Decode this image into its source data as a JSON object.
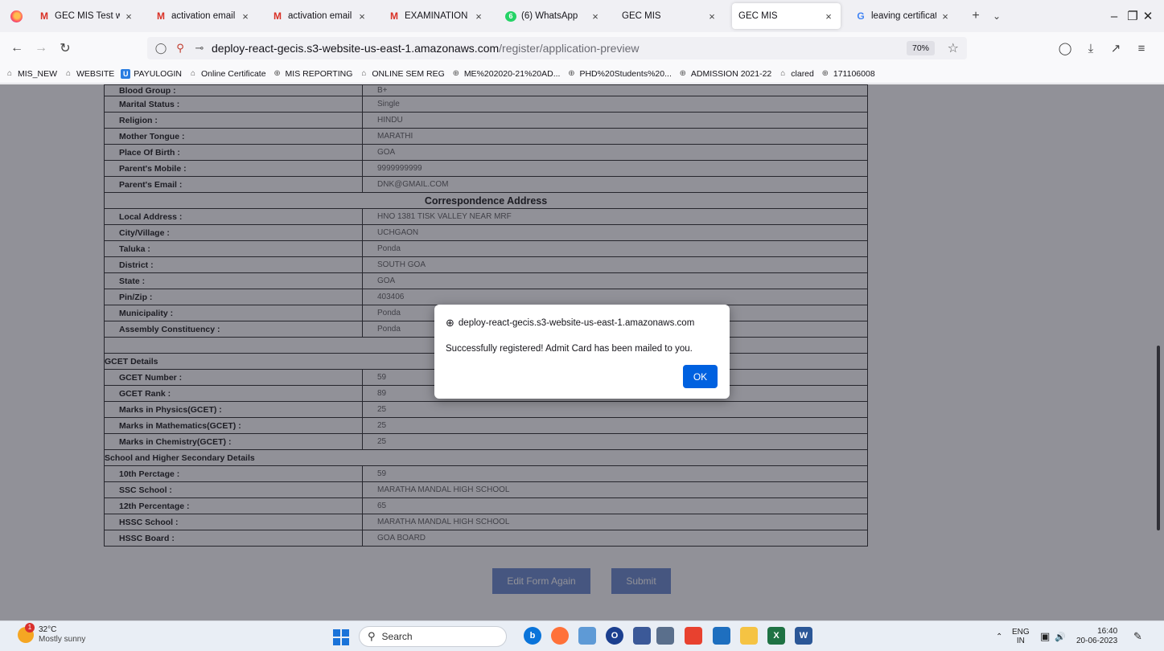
{
  "tabs": [
    {
      "title": "GEC MIS Test websi",
      "icon": "gmail-icon"
    },
    {
      "title": "activation email for",
      "icon": "gmail-icon"
    },
    {
      "title": "activation email for",
      "icon": "gmail-icon"
    },
    {
      "title": "EXAMINATION NOT",
      "icon": "gmail-icon"
    },
    {
      "title": "(6) WhatsApp",
      "icon": "whatsapp-icon"
    },
    {
      "title": "GEC MIS",
      "icon": "none"
    },
    {
      "title": "GEC MIS",
      "icon": "none",
      "active": true
    },
    {
      "title": "leaving certificate in",
      "icon": "google-icon"
    }
  ],
  "url": {
    "host": "deploy-react-gecis.s3-website-us-east-1.amazonaws.com",
    "path": "/register/application-preview",
    "zoom": "70%"
  },
  "bookmarks": [
    "MIS_NEW",
    "WEBSITE",
    "PAYULOGIN",
    "Online Certificate",
    "MIS REPORTING",
    "ONLINE SEM REG",
    "ME%202020-21%20AD...",
    "PHD%20Students%20...",
    "ADMISSION 2021-22",
    "clared",
    "171106008"
  ],
  "personal": [
    {
      "label": "Blood Group :",
      "value": "B+"
    },
    {
      "label": "Marital Status :",
      "value": "Single"
    },
    {
      "label": "Religion :",
      "value": "HINDU"
    },
    {
      "label": "Mother Tongue :",
      "value": "MARATHI"
    },
    {
      "label": "Place Of Birth :",
      "value": "GOA"
    },
    {
      "label": "Parent's Mobile :",
      "value": "9999999999"
    },
    {
      "label": "Parent's Email :",
      "value": "DNK@GMAIL.COM"
    }
  ],
  "correspondence_title": "Correspondence Address",
  "address": [
    {
      "label": "Local Address :",
      "value": "HNO 1381 TISK VALLEY NEAR MRF"
    },
    {
      "label": "City/Village :",
      "value": "UCHGAON"
    },
    {
      "label": "Taluka :",
      "value": "Ponda"
    },
    {
      "label": "District :",
      "value": "SOUTH GOA"
    },
    {
      "label": "State :",
      "value": "GOA"
    },
    {
      "label": "Pin/Zip :",
      "value": "403406"
    },
    {
      "label": "Municipality :",
      "value": "Ponda"
    },
    {
      "label": "Assembly Constituency :",
      "value": "Ponda"
    }
  ],
  "gcet_title": "GCET Details",
  "gcet": [
    {
      "label": "GCET Number :",
      "value": "59"
    },
    {
      "label": "GCET Rank :",
      "value": "89"
    },
    {
      "label": "Marks in Physics(GCET) :",
      "value": "25"
    },
    {
      "label": "Marks in Mathematics(GCET) :",
      "value": "25"
    },
    {
      "label": "Marks in Chemistry(GCET) :",
      "value": "25"
    }
  ],
  "school_title": "School and Higher Secondary Details",
  "school": [
    {
      "label": "10th Perctage :",
      "value": "59"
    },
    {
      "label": "SSC School :",
      "value": "MARATHA MANDAL HIGH SCHOOL"
    },
    {
      "label": "12th Percentage :",
      "value": "65"
    },
    {
      "label": "HSSC School :",
      "value": "MARATHA MANDAL HIGH SCHOOL"
    },
    {
      "label": "HSSC Board :",
      "value": "GOA BOARD"
    }
  ],
  "buttons": {
    "edit": "Edit Form Again",
    "submit": "Submit"
  },
  "dialog": {
    "host": "deploy-react-gecis.s3-website-us-east-1.amazonaws.com",
    "message": "Successfully registered! Admit Card has been mailed to you.",
    "ok": "OK"
  },
  "taskbar": {
    "temp": "32°C",
    "condition": "Mostly sunny",
    "badge": "1",
    "search": "Search",
    "lang1": "ENG",
    "lang2": "IN",
    "time": "16:40",
    "date": "20-06-2023"
  },
  "colors": {
    "accent": "#0061e0",
    "form_button": "#6f8fd1",
    "overlay": "rgba(25,25,40,0.48)"
  }
}
